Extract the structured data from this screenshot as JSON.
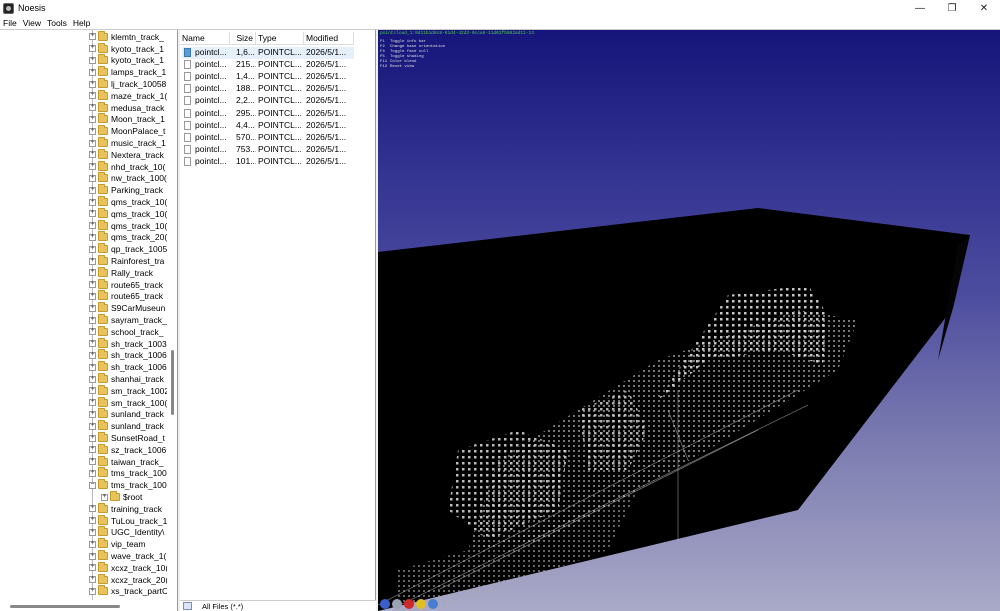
{
  "app": {
    "title": "Noesis"
  },
  "window_buttons": {
    "minimize": "—",
    "maximize": "❐",
    "close": "✕"
  },
  "menu": [
    "File",
    "View",
    "Tools",
    "Help"
  ],
  "tree": {
    "items": [
      {
        "label": "klemtn_track_",
        "expander": "+"
      },
      {
        "label": "kyoto_track_1",
        "expander": "+"
      },
      {
        "label": "kyoto_track_1",
        "expander": "+"
      },
      {
        "label": "lamps_track_1",
        "expander": "+"
      },
      {
        "label": "lj_track_10058",
        "expander": "+"
      },
      {
        "label": "maze_track_1(",
        "expander": "+"
      },
      {
        "label": "medusa_track",
        "expander": "+"
      },
      {
        "label": "Moon_track_1",
        "expander": "+"
      },
      {
        "label": "MoonPalace_t",
        "expander": "+"
      },
      {
        "label": "music_track_1",
        "expander": "+"
      },
      {
        "label": "Nextera_track",
        "expander": "+"
      },
      {
        "label": "nhd_track_10(",
        "expander": "+"
      },
      {
        "label": "nw_track_100(",
        "expander": "+"
      },
      {
        "label": "Parking_track",
        "expander": "+"
      },
      {
        "label": "qms_track_10(",
        "expander": "+"
      },
      {
        "label": "qms_track_10(",
        "expander": "+"
      },
      {
        "label": "qms_track_10(",
        "expander": "+"
      },
      {
        "label": "qms_track_20(",
        "expander": "+"
      },
      {
        "label": "qp_track_1005",
        "expander": "+"
      },
      {
        "label": "Rainforest_tra",
        "expander": "+"
      },
      {
        "label": "Rally_track",
        "expander": "+"
      },
      {
        "label": "route65_track",
        "expander": "+"
      },
      {
        "label": "route65_track",
        "expander": "+"
      },
      {
        "label": "S9CarMuseun",
        "expander": "+"
      },
      {
        "label": "sayram_track_",
        "expander": "+"
      },
      {
        "label": "school_track_",
        "expander": "+"
      },
      {
        "label": "sh_track_1003",
        "expander": "+"
      },
      {
        "label": "sh_track_1006",
        "expander": "+"
      },
      {
        "label": "sh_track_1006",
        "expander": "+"
      },
      {
        "label": "shanhai_track",
        "expander": "+"
      },
      {
        "label": "sm_track_1002",
        "expander": "+"
      },
      {
        "label": "sm_track_100(",
        "expander": "+"
      },
      {
        "label": "sunland_track",
        "expander": "+"
      },
      {
        "label": "sunland_track",
        "expander": "+"
      },
      {
        "label": "SunsetRoad_t",
        "expander": "+"
      },
      {
        "label": "sz_track_1006",
        "expander": "+"
      },
      {
        "label": "taiwan_track_",
        "expander": "+"
      },
      {
        "label": "tms_track_100",
        "expander": "+"
      },
      {
        "label": "tms_track_100",
        "expander": "−"
      },
      {
        "label": "$root",
        "expander": "+",
        "child": true
      },
      {
        "label": "training_track",
        "expander": "+"
      },
      {
        "label": "TuLou_track_1",
        "expander": "+"
      },
      {
        "label": "UGC_Identity\\",
        "expander": "+"
      },
      {
        "label": "vip_team",
        "expander": "+"
      },
      {
        "label": "wave_track_1(",
        "expander": "+"
      },
      {
        "label": "xcxz_track_10(",
        "expander": "+"
      },
      {
        "label": "xcxz_track_20(",
        "expander": "+"
      },
      {
        "label": "xs_track_partC",
        "expander": "+"
      }
    ]
  },
  "files": {
    "columns": {
      "name": "Name",
      "size": "Size",
      "type": "Type",
      "modified": "Modified"
    },
    "rows": [
      {
        "name": "pointcl...",
        "size": "1,6...",
        "type": "POINTCL...",
        "modified": "2026/5/1...",
        "selected": true
      },
      {
        "name": "pointcl...",
        "size": "215...",
        "type": "POINTCL...",
        "modified": "2026/5/1..."
      },
      {
        "name": "pointcl...",
        "size": "1,4...",
        "type": "POINTCL...",
        "modified": "2026/5/1..."
      },
      {
        "name": "pointcl...",
        "size": "188...",
        "type": "POINTCL...",
        "modified": "2026/5/1..."
      },
      {
        "name": "pointcl...",
        "size": "2,2...",
        "type": "POINTCL...",
        "modified": "2026/5/1..."
      },
      {
        "name": "pointcl...",
        "size": "295...",
        "type": "POINTCL...",
        "modified": "2026/5/1..."
      },
      {
        "name": "pointcl...",
        "size": "4,4...",
        "type": "POINTCL...",
        "modified": "2026/5/1..."
      },
      {
        "name": "pointcl...",
        "size": "570...",
        "type": "POINTCL...",
        "modified": "2026/5/1..."
      },
      {
        "name": "pointcl...",
        "size": "753...",
        "type": "POINTCL...",
        "modified": "2026/5/1..."
      },
      {
        "name": "pointcl...",
        "size": "101...",
        "type": "POINTCL...",
        "modified": "2026/5/1..."
      }
    ],
    "filter_label": "All Files (*.*)"
  },
  "viewport": {
    "caption": "pointcloud_1:0d11b1d8c8-61d4-42d3-9cca8-11d02fb082ad11-13",
    "help": [
      {
        "key": "F1",
        "text": "Toggle info bar"
      },
      {
        "key": "F2",
        "text": "Change base orientation"
      },
      {
        "key": "F4",
        "text": "Toggle face cull"
      },
      {
        "key": "F5",
        "text": "Toggle shading"
      },
      {
        "key": "F11",
        "text": "Color blend"
      },
      {
        "key": "F12",
        "text": "Reset view"
      }
    ],
    "colors": {
      "sky_top": "#15157a",
      "sky_bottom": "#a9a9c8",
      "box": "#000000",
      "points": "#ffffff",
      "caption": "#50d050"
    }
  }
}
